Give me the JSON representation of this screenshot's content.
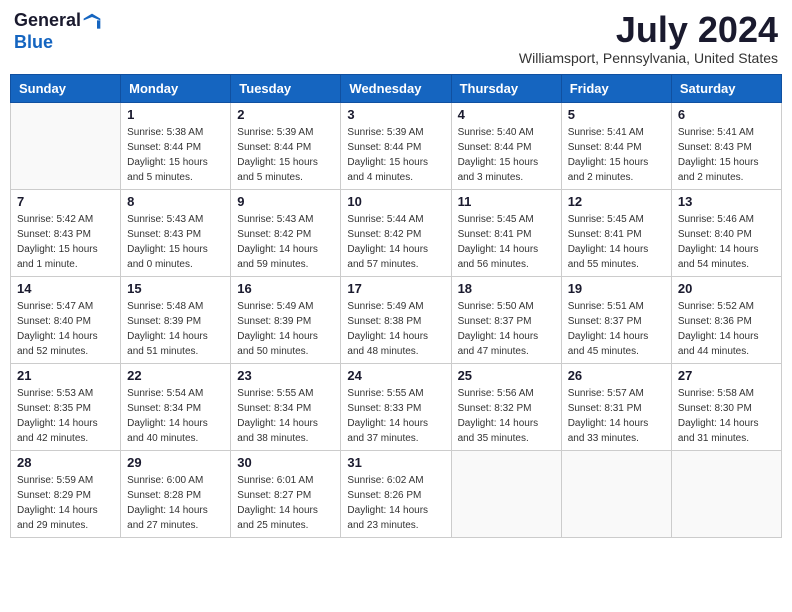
{
  "header": {
    "logo_general": "General",
    "logo_blue": "Blue",
    "month_title": "July 2024",
    "location": "Williamsport, Pennsylvania, United States"
  },
  "days_of_week": [
    "Sunday",
    "Monday",
    "Tuesday",
    "Wednesday",
    "Thursday",
    "Friday",
    "Saturday"
  ],
  "weeks": [
    [
      {
        "day": "",
        "info": ""
      },
      {
        "day": "1",
        "info": "Sunrise: 5:38 AM\nSunset: 8:44 PM\nDaylight: 15 hours\nand 5 minutes."
      },
      {
        "day": "2",
        "info": "Sunrise: 5:39 AM\nSunset: 8:44 PM\nDaylight: 15 hours\nand 5 minutes."
      },
      {
        "day": "3",
        "info": "Sunrise: 5:39 AM\nSunset: 8:44 PM\nDaylight: 15 hours\nand 4 minutes."
      },
      {
        "day": "4",
        "info": "Sunrise: 5:40 AM\nSunset: 8:44 PM\nDaylight: 15 hours\nand 3 minutes."
      },
      {
        "day": "5",
        "info": "Sunrise: 5:41 AM\nSunset: 8:44 PM\nDaylight: 15 hours\nand 2 minutes."
      },
      {
        "day": "6",
        "info": "Sunrise: 5:41 AM\nSunset: 8:43 PM\nDaylight: 15 hours\nand 2 minutes."
      }
    ],
    [
      {
        "day": "7",
        "info": "Sunrise: 5:42 AM\nSunset: 8:43 PM\nDaylight: 15 hours\nand 1 minute."
      },
      {
        "day": "8",
        "info": "Sunrise: 5:43 AM\nSunset: 8:43 PM\nDaylight: 15 hours\nand 0 minutes."
      },
      {
        "day": "9",
        "info": "Sunrise: 5:43 AM\nSunset: 8:42 PM\nDaylight: 14 hours\nand 59 minutes."
      },
      {
        "day": "10",
        "info": "Sunrise: 5:44 AM\nSunset: 8:42 PM\nDaylight: 14 hours\nand 57 minutes."
      },
      {
        "day": "11",
        "info": "Sunrise: 5:45 AM\nSunset: 8:41 PM\nDaylight: 14 hours\nand 56 minutes."
      },
      {
        "day": "12",
        "info": "Sunrise: 5:45 AM\nSunset: 8:41 PM\nDaylight: 14 hours\nand 55 minutes."
      },
      {
        "day": "13",
        "info": "Sunrise: 5:46 AM\nSunset: 8:40 PM\nDaylight: 14 hours\nand 54 minutes."
      }
    ],
    [
      {
        "day": "14",
        "info": "Sunrise: 5:47 AM\nSunset: 8:40 PM\nDaylight: 14 hours\nand 52 minutes."
      },
      {
        "day": "15",
        "info": "Sunrise: 5:48 AM\nSunset: 8:39 PM\nDaylight: 14 hours\nand 51 minutes."
      },
      {
        "day": "16",
        "info": "Sunrise: 5:49 AM\nSunset: 8:39 PM\nDaylight: 14 hours\nand 50 minutes."
      },
      {
        "day": "17",
        "info": "Sunrise: 5:49 AM\nSunset: 8:38 PM\nDaylight: 14 hours\nand 48 minutes."
      },
      {
        "day": "18",
        "info": "Sunrise: 5:50 AM\nSunset: 8:37 PM\nDaylight: 14 hours\nand 47 minutes."
      },
      {
        "day": "19",
        "info": "Sunrise: 5:51 AM\nSunset: 8:37 PM\nDaylight: 14 hours\nand 45 minutes."
      },
      {
        "day": "20",
        "info": "Sunrise: 5:52 AM\nSunset: 8:36 PM\nDaylight: 14 hours\nand 44 minutes."
      }
    ],
    [
      {
        "day": "21",
        "info": "Sunrise: 5:53 AM\nSunset: 8:35 PM\nDaylight: 14 hours\nand 42 minutes."
      },
      {
        "day": "22",
        "info": "Sunrise: 5:54 AM\nSunset: 8:34 PM\nDaylight: 14 hours\nand 40 minutes."
      },
      {
        "day": "23",
        "info": "Sunrise: 5:55 AM\nSunset: 8:34 PM\nDaylight: 14 hours\nand 38 minutes."
      },
      {
        "day": "24",
        "info": "Sunrise: 5:55 AM\nSunset: 8:33 PM\nDaylight: 14 hours\nand 37 minutes."
      },
      {
        "day": "25",
        "info": "Sunrise: 5:56 AM\nSunset: 8:32 PM\nDaylight: 14 hours\nand 35 minutes."
      },
      {
        "day": "26",
        "info": "Sunrise: 5:57 AM\nSunset: 8:31 PM\nDaylight: 14 hours\nand 33 minutes."
      },
      {
        "day": "27",
        "info": "Sunrise: 5:58 AM\nSunset: 8:30 PM\nDaylight: 14 hours\nand 31 minutes."
      }
    ],
    [
      {
        "day": "28",
        "info": "Sunrise: 5:59 AM\nSunset: 8:29 PM\nDaylight: 14 hours\nand 29 minutes."
      },
      {
        "day": "29",
        "info": "Sunrise: 6:00 AM\nSunset: 8:28 PM\nDaylight: 14 hours\nand 27 minutes."
      },
      {
        "day": "30",
        "info": "Sunrise: 6:01 AM\nSunset: 8:27 PM\nDaylight: 14 hours\nand 25 minutes."
      },
      {
        "day": "31",
        "info": "Sunrise: 6:02 AM\nSunset: 8:26 PM\nDaylight: 14 hours\nand 23 minutes."
      },
      {
        "day": "",
        "info": ""
      },
      {
        "day": "",
        "info": ""
      },
      {
        "day": "",
        "info": ""
      }
    ]
  ]
}
